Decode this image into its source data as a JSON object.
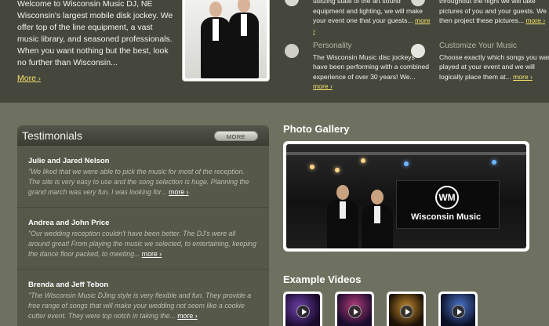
{
  "intro": {
    "text": "Welcome to Wisconsin Music DJ, NE Wisconsin's largest mobile disk jockey. We offer top of the line equipment, a vast music library, and seasoned professionals. When you want nothing but the best, look no further than Wisconsin...",
    "more_label": "More",
    "more_arrow": "›"
  },
  "features": {
    "top_left": {
      "text": "utilizing state of the art sound equipment and lighting, we will make your event one that your guests...",
      "more": "more ›"
    },
    "top_right": {
      "text": "throughout the night we will take pictures of you and your guests. We then project these pictures...",
      "more": "more ›"
    },
    "personality": {
      "title": "Personality",
      "text": "The Wisconsin Music disc jockeys have been performing with a combined experience of over 30 years! We...",
      "more": "more ›"
    },
    "customize": {
      "title": "Customize Your Music",
      "text": "Choose exactly which songs you want played at your event and we will logically place them at...",
      "more": "more ›"
    }
  },
  "testimonials": {
    "title": "Testimonials",
    "more_button": "MORE",
    "items": [
      {
        "name": "Julie and Jared Nelson",
        "quote": "\"We liked that we were able to pick the music for most of the reception. The site is very easy to use and the song selection is huge. Planning the grand march was very fun. I was looking for...",
        "more": "more ›"
      },
      {
        "name": "Andrea and John Price",
        "quote": "\"Our wedding reception couldn't have been better. The DJ's were all around great! From playing the music we selected, to entertaining, keeping the dance floor packed, to meeting...",
        "more": "more ›"
      },
      {
        "name": "Brenda and Jeff Tebon",
        "quote": "\"The Wisconsin Music DJing style is very flexible and fun. They provide a free range of songs that will make your wedding not seem like a cookie cutter event. They were top notch in taking the...",
        "more": "more ›"
      }
    ]
  },
  "gallery": {
    "title": "Photo Gallery",
    "banner_text": "Wisconsin Music",
    "banner_logo": "WM"
  },
  "videos": {
    "title": "Example Videos",
    "count": 4
  }
}
